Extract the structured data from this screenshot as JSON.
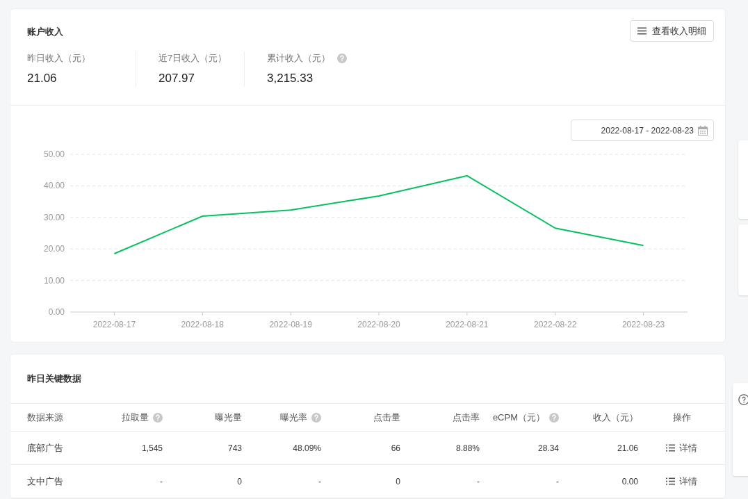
{
  "income": {
    "title": "账户收入",
    "detail_button": "查看收入明细",
    "stats": [
      {
        "label": "昨日收入（元）",
        "value": "21.06",
        "help": false
      },
      {
        "label": "近7日收入（元）",
        "value": "207.97",
        "help": false
      },
      {
        "label": "累计收入（元）",
        "value": "3,215.33",
        "help": true
      }
    ],
    "date_range": "2022-08-17 - 2022-08-23",
    "chart_data": {
      "type": "line",
      "categories": [
        "2022-08-17",
        "2022-08-18",
        "2022-08-19",
        "2022-08-20",
        "2022-08-21",
        "2022-08-22",
        "2022-08-23"
      ],
      "grid": true,
      "series": [
        {
          "color": "#07c160",
          "values": [
            18.5,
            30.4,
            32.3,
            36.8,
            43.2,
            26.6,
            21.1
          ]
        }
      ],
      "ylim": [
        0,
        50
      ],
      "yticks": [
        {
          "value": 0,
          "label": "0.00"
        },
        {
          "value": 10,
          "label": "10.00"
        },
        {
          "value": 20,
          "label": "20.00"
        },
        {
          "value": 30,
          "label": "30.00"
        },
        {
          "value": 40,
          "label": "40.00"
        },
        {
          "value": 50,
          "label": "50.00"
        }
      ]
    }
  },
  "key_data": {
    "title": "昨日关键数据",
    "columns": [
      {
        "label": "数据来源",
        "help": false
      },
      {
        "label": "拉取量",
        "help": true
      },
      {
        "label": "曝光量",
        "help": false
      },
      {
        "label": "曝光率",
        "help": true
      },
      {
        "label": "点击量",
        "help": false
      },
      {
        "label": "点击率",
        "help": false
      },
      {
        "label": "eCPM（元）",
        "help": true
      },
      {
        "label": "收入（元）",
        "help": false
      },
      {
        "label": "操作",
        "help": false
      }
    ],
    "rows": [
      {
        "cells": [
          "底部广告",
          "1,545",
          "743",
          "48.09%",
          "66",
          "8.88%",
          "28.34",
          "21.06"
        ],
        "action": "详情"
      },
      {
        "cells": [
          "文中广告",
          "-",
          "0",
          "-",
          "0",
          "-",
          "-",
          "0.00"
        ],
        "action": "详情"
      }
    ]
  }
}
